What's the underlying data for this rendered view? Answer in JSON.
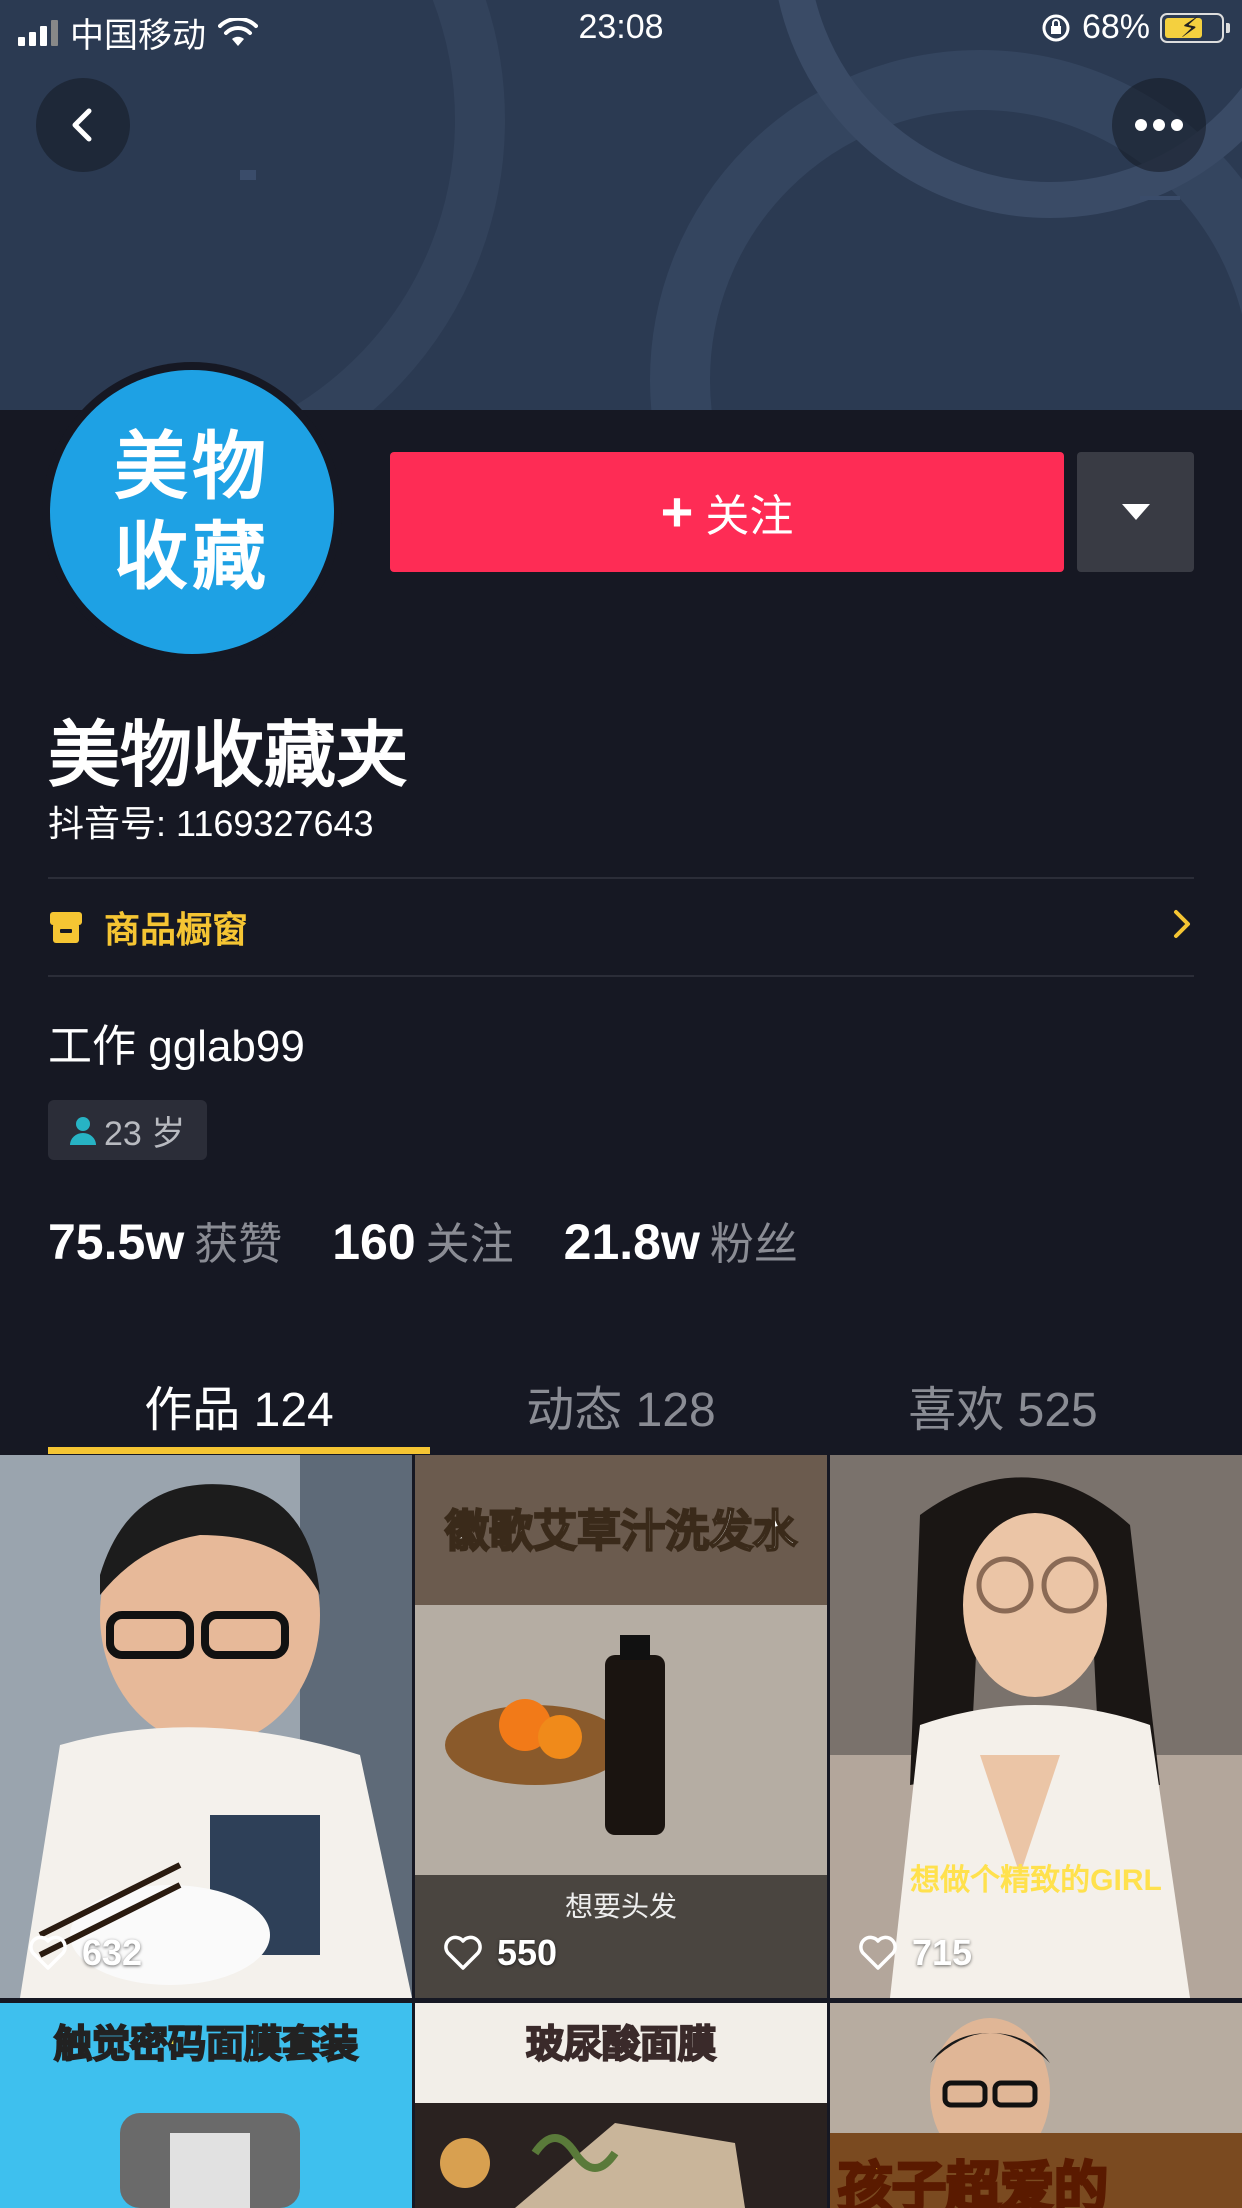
{
  "status_bar": {
    "carrier": "中国移动",
    "time": "23:08",
    "battery": "68%",
    "battery_level": 0.68
  },
  "header": {
    "back_icon": "chevron-left-icon",
    "more_icon": "ellipsis-icon"
  },
  "profile": {
    "avatar_line1": "美物",
    "avatar_line2": "收藏",
    "follow_label": "关注",
    "nickname": "美物收藏夹",
    "douyin_id": "抖音号: 1169327643",
    "showcase_label": "商品橱窗",
    "bio": "工作 gglab99",
    "age": "23 岁"
  },
  "stats": [
    {
      "value": "75.5w",
      "label": "获赞"
    },
    {
      "value": "160",
      "label": "关注"
    },
    {
      "value": "21.8w",
      "label": "粉丝"
    }
  ],
  "tabs": [
    {
      "label": "作品 124"
    },
    {
      "label": "动态 128"
    },
    {
      "label": "喜欢 525"
    }
  ],
  "videos": [
    {
      "likes": "632",
      "caption": ""
    },
    {
      "likes": "550",
      "caption": "徽歌艾草汁洗发水",
      "subtitle": "想要头发"
    },
    {
      "likes": "715",
      "caption": "",
      "subtitle": "想做个精致的GIRL"
    },
    {
      "caption": "触觉密码面膜套装"
    },
    {
      "caption": "玻尿酸面膜"
    },
    {
      "caption": "孩子超爱的"
    }
  ],
  "colors": {
    "background": "#161823",
    "follow": "#fe2c55",
    "accent": "#f5c533",
    "avatar": "#1ea1e4"
  }
}
